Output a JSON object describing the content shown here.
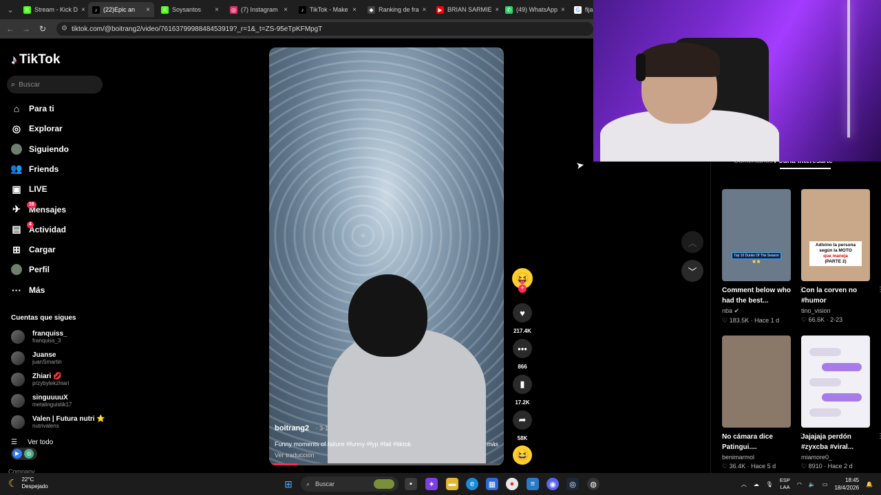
{
  "browser": {
    "tabs": [
      {
        "label": "Stream - Kick D",
        "fav": "#53fc18",
        "icon": "K"
      },
      {
        "label": "(22)Epic an",
        "fav": "#000000",
        "icon": "♪"
      },
      {
        "label": "Soysantos",
        "fav": "#53fc18",
        "icon": "K"
      },
      {
        "label": "(7) Instagram",
        "fav": "#e1306c",
        "icon": "◎"
      },
      {
        "label": "TikTok - Make",
        "fav": "#000000",
        "icon": "♪"
      },
      {
        "label": "Ranking de fra",
        "fav": "#444444",
        "icon": "◆"
      },
      {
        "label": "BRIAN SARMIE",
        "fav": "#ff0000",
        "icon": "▶"
      },
      {
        "label": "(49) WhatsApp",
        "fav": "#25d366",
        "icon": "✆"
      },
      {
        "label": "fija",
        "fav": "#ffffff",
        "icon": "G"
      }
    ],
    "url": "tiktok.com/@boitrang2/video/7616379998848453919?_r=1&_t=ZS-95eTpKFMpgT"
  },
  "sidebar": {
    "logo": "TikTok",
    "search_placeholder": "Buscar",
    "nav": [
      {
        "label": "Para ti",
        "icon": "⌂"
      },
      {
        "label": "Explorar",
        "icon": "◎"
      },
      {
        "label": "Siguiendo",
        "icon": "●"
      },
      {
        "label": "Friends",
        "icon": "👥"
      },
      {
        "label": "LIVE",
        "icon": "▣"
      },
      {
        "label": "Mensajes",
        "icon": "✈",
        "badge": "16"
      },
      {
        "label": "Actividad",
        "icon": "▤",
        "badge": "4"
      },
      {
        "label": "Cargar",
        "icon": "⊞"
      },
      {
        "label": "Perfil",
        "icon": "●"
      },
      {
        "label": "Más",
        "icon": "···"
      }
    ],
    "following_title": "Cuentas que sigues",
    "following": [
      {
        "name": "franquiss_",
        "user": "franquiss_3"
      },
      {
        "name": "Juanse",
        "user": "juanSmartin"
      },
      {
        "name": "Zhiari 💋",
        "user": "przybytekzhiari"
      },
      {
        "name": "singuuuuX",
        "user": "metalinguistik17"
      },
      {
        "name": "Valen | Futura nutri ⭐",
        "user": "nutrivalens"
      }
    ],
    "see_all": "Ver todo",
    "company": "Company"
  },
  "video": {
    "author": "boitrang2",
    "date": "· 3-12",
    "caption": "Funny moments of failure #funny #fyp #fail #tiktok",
    "more": "más",
    "translate": "Ver traducción",
    "progress": 0.12
  },
  "actions": {
    "likes": "217.4K",
    "comments": "866",
    "saves": "17.2K",
    "shares": "58K"
  },
  "right_panel": {
    "tab_comments": "Comentarios",
    "tab_interest": "Podría interesarte",
    "videos": [
      {
        "title": "Comment below who had the best...",
        "author": "nba ✔",
        "stats": "♡ 183.5K · Hace 1 d",
        "overlay": "Top 10 Dunks Of The Season ⭐⭐",
        "thumb_color": "#6b7a8a"
      },
      {
        "title": "Con la corven no #humor",
        "author": "tino_vision",
        "stats": "♡ 66.6K · 2-23",
        "overlay_line1": "Adivino la persona según la MOTO",
        "overlay_red": "que maneja",
        "overlay_line3": "(PARTE 2)",
        "thumb_color": "#c9a88a"
      },
      {
        "title": "No cámara dice Patingui....",
        "author": "benimarmol",
        "stats": "♡ 36.4K · Hace 5 d",
        "thumb_color": "#8a7868"
      },
      {
        "title": "Jajajaja perdón #zyxcba #viral...",
        "author": "miamore0_",
        "stats": "♡ 8910 · Hace 2 d",
        "thumb_color": "#f2f0f7"
      }
    ]
  },
  "taskbar": {
    "temp": "22°C",
    "weather": "Despejado",
    "search": "Buscar",
    "lang1": "ESP",
    "lang2": "LAA",
    "time": "18:45",
    "date": "18/4/2026"
  }
}
